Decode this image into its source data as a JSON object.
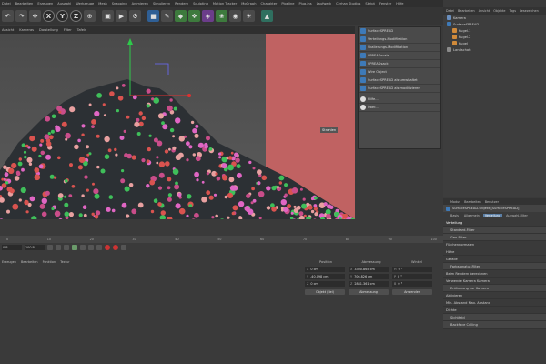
{
  "menubar": [
    "Datei",
    "Bearbeiten",
    "Erzeugen",
    "Auswahl",
    "Werkzeuge",
    "Mesh",
    "Snapping",
    "Animieren",
    "Simulieren",
    "Rendern",
    "Sculpting",
    "Motion Tracker",
    "MoGraph",
    "Charakter",
    "Pipeline",
    "Plug-ins",
    "Laufwerk",
    "Cerhan Studios",
    "Skript",
    "Fenster",
    "Hilfe"
  ],
  "toolbar": {
    "axis_buttons": [
      "X",
      "Y",
      "Z"
    ]
  },
  "viewport": {
    "menu": [
      "Ansicht",
      "Kameras",
      "Darstellung",
      "Filter",
      "Tafeln"
    ],
    "tag_label": "Strahlen"
  },
  "dropdown": {
    "items": [
      "SurfaceSPREAD",
      "Verteilungs-Modifikation",
      "Skalierungs-Modifikation",
      "SPREADscale",
      "SPREADsack",
      "Wire Object",
      "SurfaceSPREAD als umwhaltet",
      "SurfaceSPREAD als modifizieren"
    ],
    "options": [
      "Hilfe...",
      "Über..."
    ]
  },
  "object_manager": {
    "menu": [
      "Datei",
      "Bearbeiten",
      "Ansicht",
      "Objekte",
      "Tags",
      "Lesezeichen"
    ],
    "objects": [
      {
        "name": "Kamera",
        "color": "#6a8fbf"
      },
      {
        "name": "SurfaceSPREAD",
        "color": "#3e7ab8"
      },
      {
        "name": "Kugel.1",
        "color": "#d08a3a"
      },
      {
        "name": "Kugel.2",
        "color": "#d08a3a"
      },
      {
        "name": "Kugel",
        "color": "#d08a3a"
      },
      {
        "name": "Landschaft",
        "color": "#8a8a8a"
      }
    ]
  },
  "attribute_manager": {
    "menu": [
      "Modus",
      "Bearbeiten",
      "Benutzer"
    ],
    "header": "SurfaceSPREAD-Objekt [SurfaceSPREAD]",
    "tabs": [
      {
        "label": "Basis",
        "active": false
      },
      {
        "label": "Allgemein",
        "active": false
      },
      {
        "label": "Verteilung",
        "active": true
      },
      {
        "label": "Auswahl-Filter",
        "active": false
      }
    ],
    "section": "Verteilung",
    "rows": [
      {
        "label": "Standard-Filter",
        "group": true
      },
      {
        "label": "Geo-Filter",
        "group": true
      },
      {
        "label": "Flächennormalen",
        "group": false
      },
      {
        "label": "Höhe",
        "group": false
      },
      {
        "label": "Gefälle",
        "group": false
      },
      {
        "label": "Farbsignatur-Filter",
        "group": true
      },
      {
        "label": "Beim Rendern berechnen",
        "group": false
      },
      {
        "label": "Verwende Kamera   Kamera",
        "group": false
      },
      {
        "label": "Entfernung zur Kamera",
        "group": true
      },
      {
        "label": "Aktivieren",
        "group": false
      },
      {
        "label": "Min. Abstand   Max. Abstand",
        "group": false
      },
      {
        "label": "Dichte",
        "group": false
      },
      {
        "label": "Sichtfeld",
        "group": true
      },
      {
        "label": "Backface Culling",
        "group": true
      }
    ]
  },
  "timeline": {
    "ticks": [
      "0",
      "10",
      "20",
      "30",
      "40",
      "50",
      "60",
      "70",
      "80",
      "90",
      "100"
    ],
    "start_field": "0 B",
    "end_field": "100 B"
  },
  "material_manager": {
    "menu": [
      "Erzeugen",
      "Bearbeiten",
      "Funktion",
      "Textur"
    ]
  },
  "coordinates": {
    "headers": [
      "Position",
      "Abmessung",
      "Winkel"
    ],
    "rows": [
      {
        "pos_axis": "X",
        "pos": "0 cm",
        "size_axis": "X",
        "size": "3300.865 cm",
        "rot_axis": "H",
        "rot": "0 °"
      },
      {
        "pos_axis": "Y",
        "pos": "-40.098 cm",
        "size_axis": "Y",
        "size": "706.826 cm",
        "rot_axis": "P",
        "rot": "0 °"
      },
      {
        "pos_axis": "Z",
        "pos": "0 cm",
        "size_axis": "Z",
        "size": "2841.361 cm",
        "rot_axis": "B",
        "rot": "0 °"
      }
    ],
    "mode_select": "Objekt (Rel)",
    "size_select": "Abmessung",
    "apply_label": "Anwenden"
  }
}
